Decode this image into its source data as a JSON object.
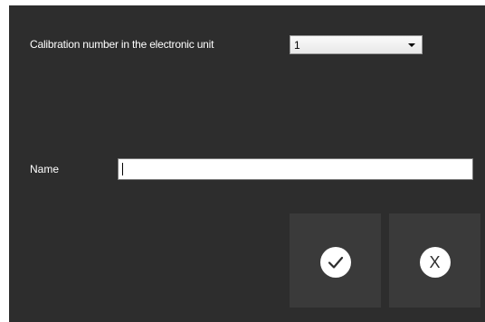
{
  "calibration": {
    "label": "Calibration number in the electronic unit",
    "selected_value": "1"
  },
  "name": {
    "label": "Name",
    "value": ""
  },
  "buttons": {
    "ok_icon": "checkmark-icon",
    "cancel_glyph": "X"
  },
  "colors": {
    "background": "#2d2d2d",
    "button_background": "#3a3a3a",
    "icon_circle": "#ffffff"
  }
}
